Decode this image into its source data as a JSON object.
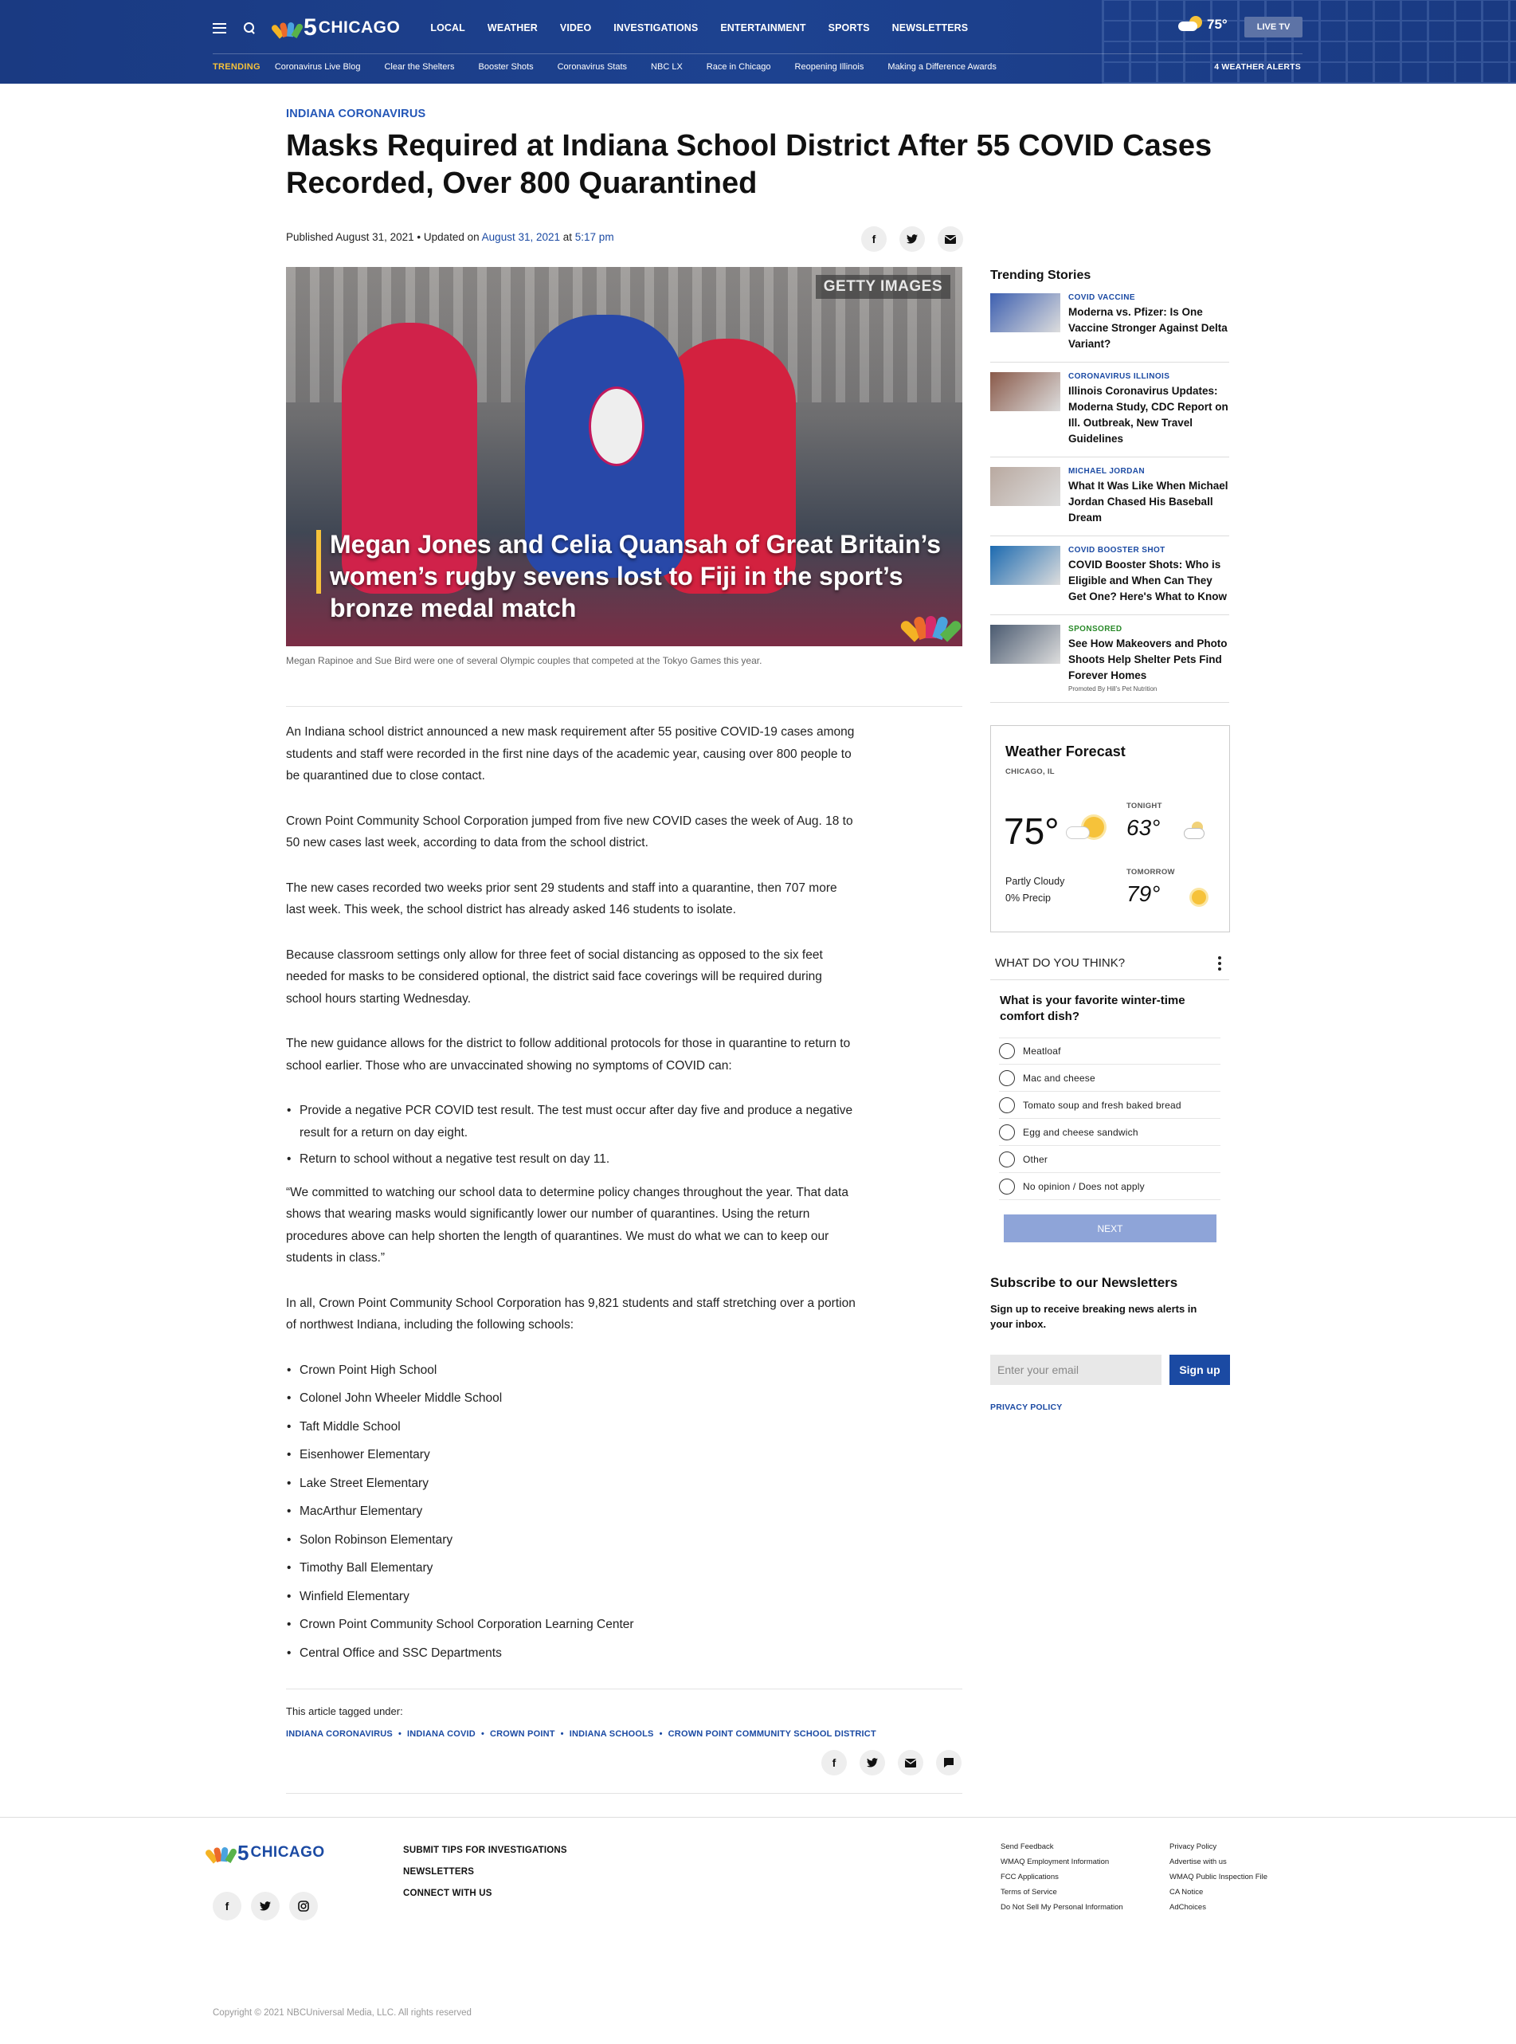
{
  "header": {
    "logo_num": "5",
    "logo_city": "CHICAGO",
    "nav": [
      "LOCAL",
      "WEATHER",
      "VIDEO",
      "INVESTIGATIONS",
      "ENTERTAINMENT",
      "SPORTS",
      "NEWSLETTERS"
    ],
    "temp": "75°",
    "live_tv": "LIVE TV",
    "trending_label": "TRENDING",
    "trending": [
      "Coronavirus Live Blog",
      "Clear the Shelters",
      "Booster Shots",
      "Coronavirus Stats",
      "NBC LX",
      "Race in Chicago",
      "Reopening Illinois",
      "Making a Difference Awards"
    ],
    "weather_alerts": "4 WEATHER ALERTS",
    "icons": [
      "menu-icon",
      "search-icon",
      "partly-cloudy-icon"
    ]
  },
  "article": {
    "eyebrow": "INDIANA CORONAVIRUS",
    "headline": "Masks Required at Indiana School District After 55 COVID Cases Recorded, Over 800 Quarantined",
    "byline_published": "Published August 31, 2021 • Updated on ",
    "byline_updated_date": "August 31, 2021",
    "byline_at": " at ",
    "byline_time": "5:17 pm",
    "share_icons": [
      "facebook-icon",
      "twitter-icon",
      "email-icon"
    ],
    "hero": {
      "getty": "GETTY IMAGES",
      "caption_overlay": "Megan Jones and Celia Quansah of Great Britain’s women’s rugby sevens lost to Fiji in the sport’s bronze medal match"
    },
    "photo_caption": "Megan Rapinoe and Sue Bird were one of several Olympic couples that competed at the Tokyo Games this year.",
    "paragraphs": [
      "An Indiana school district announced a new mask requirement after 55 positive COVID-19 cases among students and staff were recorded in the first nine days of the academic year, causing over 800 people to be quarantined due to close contact.",
      "Crown Point Community School Corporation jumped from five new COVID cases the week of Aug. 18 to 50 new cases last week, according to data from the school district.",
      "The new cases recorded two weeks prior sent 29 students and staff into a quarantine, then 707 more last week. This week, the school district has already asked 146 students to isolate.",
      "Because classroom settings only allow for three feet of social distancing as opposed to the six feet needed for masks to be considered optional, the district said face coverings will be required during school hours starting Wednesday.",
      "The new guidance allows for the district to follow additional protocols for those in quarantine to return to school earlier. Those who are unvaccinated showing no symptoms of COVID can:"
    ],
    "protocols": [
      "Provide a negative PCR COVID test result. The test must occur after day five and produce a negative result for a return on day eight.",
      "Return to school without a negative test result on day 11."
    ],
    "quote": "“We committed to watching our school data to determine policy changes throughout the year. That data shows that wearing masks would significantly lower our number of quarantines. Using the return procedures above can help shorten the length of quarantines. We must do what we can to keep our students in class.”",
    "schools_intro": "In all, Crown Point Community School Corporation has 9,821 students and staff stretching over a portion of northwest Indiana, including the following schools:",
    "schools": [
      "Crown Point High School",
      "Colonel John Wheeler Middle School",
      "Taft Middle School",
      "Eisenhower Elementary",
      "Lake Street Elementary",
      "MacArthur Elementary",
      "Solon Robinson Elementary",
      "Timothy Ball Elementary",
      "Winfield Elementary",
      "Crown Point Community School Corporation Learning Center",
      "Central Office and SSC Departments"
    ],
    "tagged_label": "This article tagged under:",
    "tags": [
      "INDIANA CORONAVIRUS",
      "INDIANA COVID",
      "CROWN POINT",
      "INDIANA SCHOOLS",
      "CROWN POINT COMMUNITY SCHOOL DISTRICT"
    ],
    "bottom_share_icons": [
      "facebook-icon",
      "twitter-icon",
      "email-icon",
      "comment-icon"
    ]
  },
  "sidebar": {
    "trending_title": "Trending Stories",
    "trending": [
      {
        "cat": "COVID VACCINE",
        "title": "Moderna vs. Pfizer: Is One Vaccine Stronger Against Delta Variant?",
        "thumb_color": "#3d5fb0"
      },
      {
        "cat": "CORONAVIRUS ILLINOIS",
        "title": "Illinois Coronavirus Updates: Moderna Study, CDC Report on Ill. Outbreak, New Travel Guidelines",
        "thumb_color": "#8a5a4a"
      },
      {
        "cat": "MICHAEL JORDAN",
        "title": "What It Was Like When Michael Jordan Chased His Baseball Dream",
        "thumb_color": "#b9a9a0"
      },
      {
        "cat": "COVID BOOSTER SHOT",
        "title": "COVID Booster Shots: Who is Eligible and When Can They Get One? Here's What to Know",
        "thumb_color": "#1c6ab0"
      },
      {
        "cat": "SPONSORED",
        "title": "See How Makeovers and Photo Shoots Help Shelter Pets Find Forever Homes",
        "thumb_color": "#4a5a70",
        "promo": "Promoted By Hill's Pet Nutrition"
      }
    ],
    "weather": {
      "title": "Weather Forecast",
      "location": "CHICAGO, IL",
      "temp": "75°",
      "condition": "Partly Cloudy",
      "precip": "0% Precip",
      "tonight_label": "TONIGHT",
      "tonight_temp": "63°",
      "tomorrow_label": "TOMORROW",
      "tomorrow_temp": "79°"
    },
    "poll": {
      "heading": "WHAT DO YOU THINK?",
      "question": "What is your favorite winter-time comfort dish?",
      "options": [
        "Meatloaf",
        "Mac and cheese",
        "Tomato soup and fresh baked bread",
        "Egg and cheese sandwich",
        "Other",
        "No opinion / Does not apply"
      ],
      "next": "NEXT"
    },
    "newsletter": {
      "title": "Subscribe to our Newsletters",
      "desc": "Sign up to receive breaking news alerts in your inbox.",
      "placeholder": "Enter your email",
      "button": "Sign up",
      "privacy": "PRIVACY POLICY"
    }
  },
  "footer": {
    "links": [
      "SUBMIT TIPS FOR INVESTIGATIONS",
      "NEWSLETTERS",
      "CONNECT WITH US"
    ],
    "col1": [
      "Send Feedback",
      "WMAQ Employment Information",
      "FCC Applications",
      "Terms of Service",
      "Do Not Sell My Personal Information"
    ],
    "col2": [
      "Privacy Policy",
      "Advertise with us",
      "WMAQ Public Inspection File",
      "CA Notice",
      "AdChoices"
    ],
    "social_icons": [
      "facebook-icon",
      "twitter-icon",
      "instagram-icon"
    ],
    "copyright": "Copyright © 2021 NBCUniversal Media, LLC. All rights reserved"
  },
  "colors": {
    "brand_blue": "#1a3a80",
    "link_blue": "#1b4aa3",
    "trending_yellow": "#f6c23a",
    "sponsored_green": "#2a8a2a"
  }
}
